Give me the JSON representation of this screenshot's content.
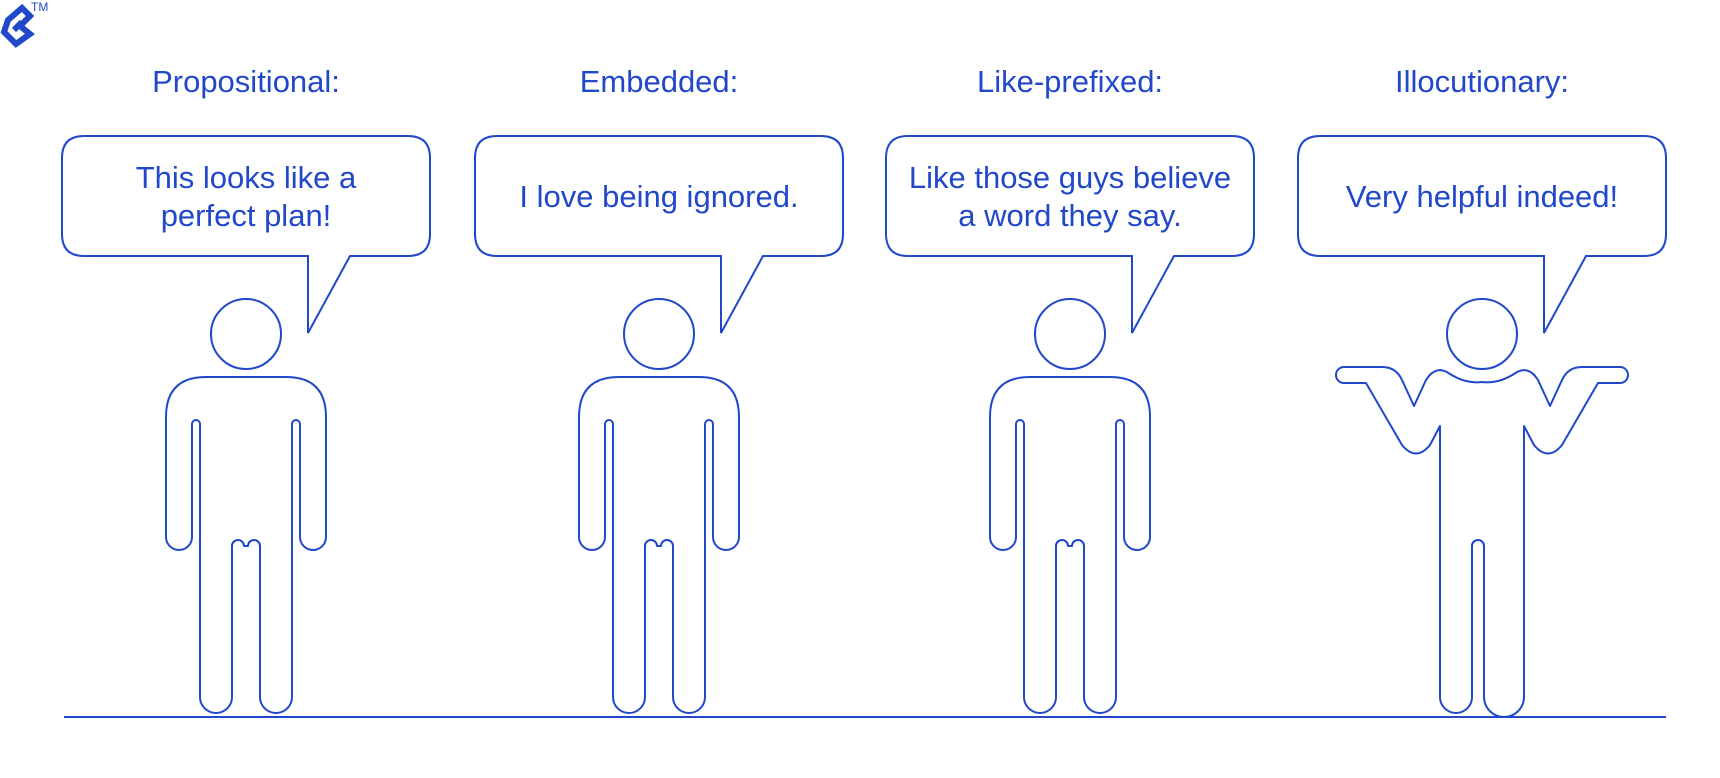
{
  "colors": {
    "stroke": "#2148c8",
    "text": "#2148c8",
    "background": "#ffffff"
  },
  "logo": {
    "icon": "toptal-logo-icon",
    "trademark": "TM"
  },
  "panels": [
    {
      "label": "Propositional:",
      "quote_lines": [
        "This looks like a",
        "perfect plan!"
      ],
      "pose": "standing"
    },
    {
      "label": "Embedded:",
      "quote_lines": [
        "I love being ignored."
      ],
      "pose": "standing"
    },
    {
      "label": "Like-prefixed:",
      "quote_lines": [
        "Like those guys believe",
        "a word they say."
      ],
      "pose": "standing"
    },
    {
      "label": "Illocutionary:",
      "quote_lines": [
        "Very helpful indeed!"
      ],
      "pose": "shrugging"
    }
  ]
}
